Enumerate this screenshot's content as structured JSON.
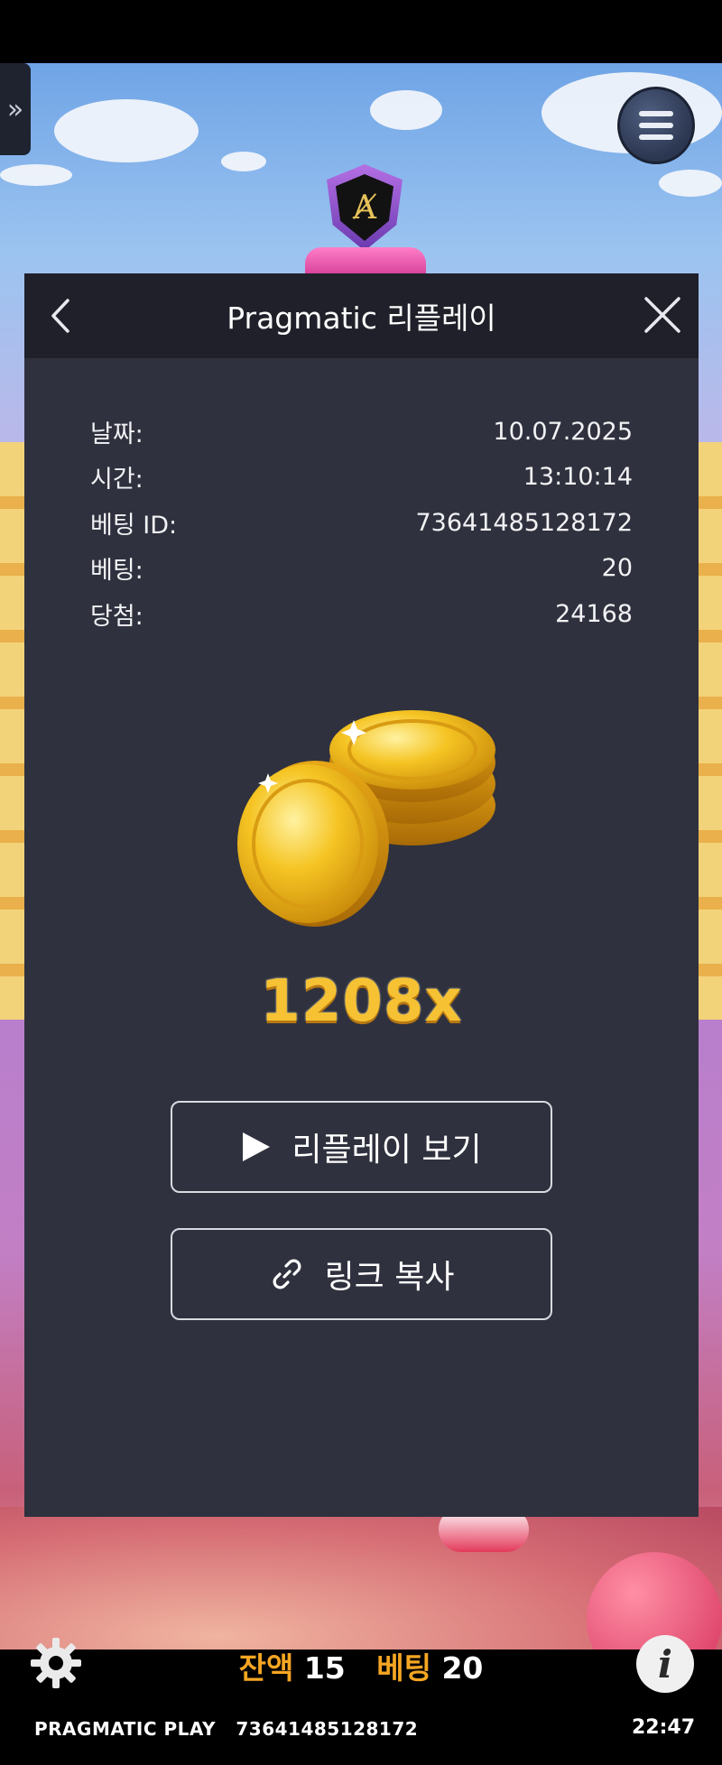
{
  "side_tab": {
    "icon": "double-chevron-right-icon",
    "glyph": "»"
  },
  "dialog": {
    "title": "Pragmatic 리플레이",
    "info_rows": [
      {
        "label": "날짜:",
        "value": "10.07.2025"
      },
      {
        "label": "시간:",
        "value": "13:10:14"
      },
      {
        "label": "베팅 ID:",
        "value": "73641485128172"
      },
      {
        "label": "베팅:",
        "value": "20"
      },
      {
        "label": "당첨:",
        "value": "24168"
      }
    ],
    "multiplier": "1208x",
    "replay_button": "리플레이 보기",
    "copy_link_button": "링크 복사"
  },
  "bottom": {
    "balance_label": "잔액",
    "balance_value": "15",
    "bet_label": "베팅",
    "bet_value": "20",
    "provider": "PRAGMATIC PLAY",
    "round_id": "73641485128172",
    "time": "22:47",
    "info_glyph": "i"
  },
  "colors": {
    "dialog_bg": "#2f313e",
    "header_bg": "#1f2029",
    "accent_orange": "#f6a623",
    "multiplier_gold": "#f6c233"
  }
}
